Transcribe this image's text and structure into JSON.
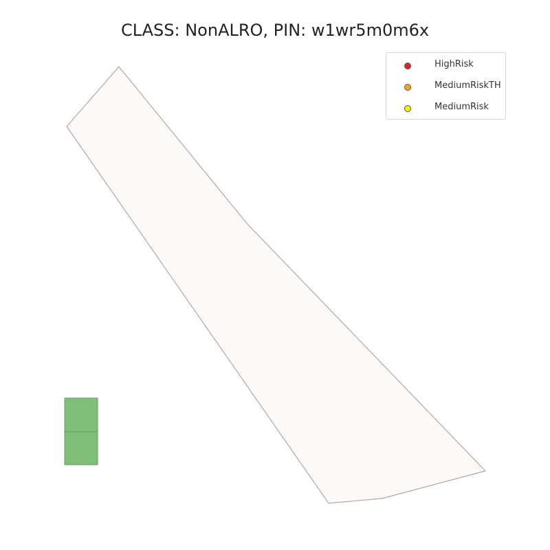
{
  "title": "CLASS: NonALRO, PIN: w1wr5m0m6x",
  "legend": {
    "items": [
      {
        "label": "HighRisk",
        "color": "#d62728"
      },
      {
        "label": "MediumRiskTH",
        "color": "#f5a623"
      },
      {
        "label": "MediumRisk",
        "color": "#ffee00"
      }
    ]
  },
  "map": {
    "parcel_fill": "#fdf9f6",
    "parcel_stroke": "#aaaaaa",
    "green_fill": "#7fbf7b",
    "green_stroke": "#6b9a68"
  }
}
